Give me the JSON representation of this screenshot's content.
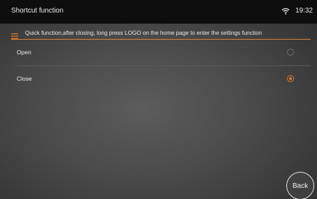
{
  "statusbar": {
    "title": "Shortcut function",
    "time": "19:32",
    "wifi_icon": "wifi-icon"
  },
  "hint": {
    "icon": "menu-icon",
    "text": "Quick function,after closing, long press LOGO on the home page to enter the settings function"
  },
  "options": [
    {
      "label": "Open",
      "selected": false
    },
    {
      "label": "Close",
      "selected": true
    }
  ],
  "back": {
    "label": "Back"
  },
  "colors": {
    "accent": "#e07b2e",
    "statusbar_bg": "#0e0e0e"
  }
}
